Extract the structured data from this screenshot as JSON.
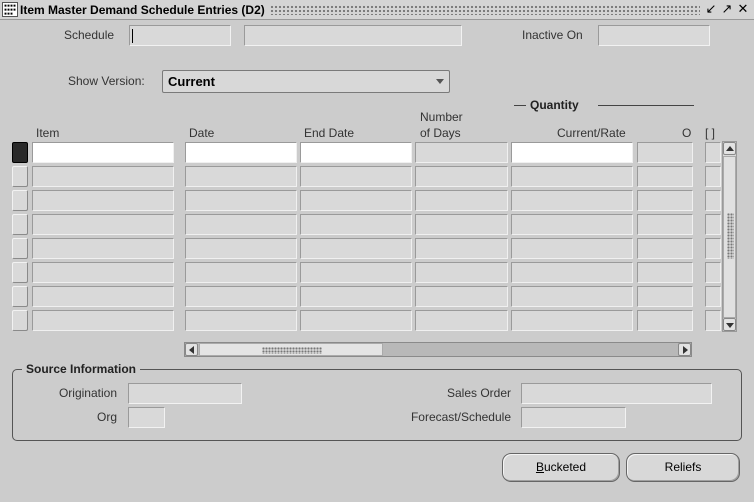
{
  "window": {
    "title": "Item Master Demand Schedule Entries (D2)",
    "controls": {
      "minimize": "↙",
      "maximize": "↗",
      "close": "✕"
    }
  },
  "header": {
    "schedule_label": "Schedule",
    "schedule_value": "",
    "schedule_desc": "",
    "inactive_on_label": "Inactive On",
    "inactive_on_value": "",
    "show_version_label": "Show Version:",
    "show_version_value": "Current"
  },
  "table": {
    "group_title": "Quantity",
    "columns": {
      "item": "Item",
      "date": "Date",
      "end_date": "End Date",
      "number_of_days_line1": "Number",
      "number_of_days_line2": "of Days",
      "current_rate": "Current/Rate",
      "o": "O",
      "flag": "[ ]"
    },
    "row_count": 8,
    "current_row": 0
  },
  "source_information": {
    "title": "Source Information",
    "origination_label": "Origination",
    "origination_value": "",
    "org_label": "Org",
    "org_value": "",
    "sales_order_label": "Sales Order",
    "sales_order_value": "",
    "forecast_schedule_label": "Forecast/Schedule",
    "forecast_schedule_value": ""
  },
  "buttons": {
    "bucketed_mnemonic": "B",
    "bucketed_rest": "ucketed",
    "reliefs": "Reliefs"
  }
}
